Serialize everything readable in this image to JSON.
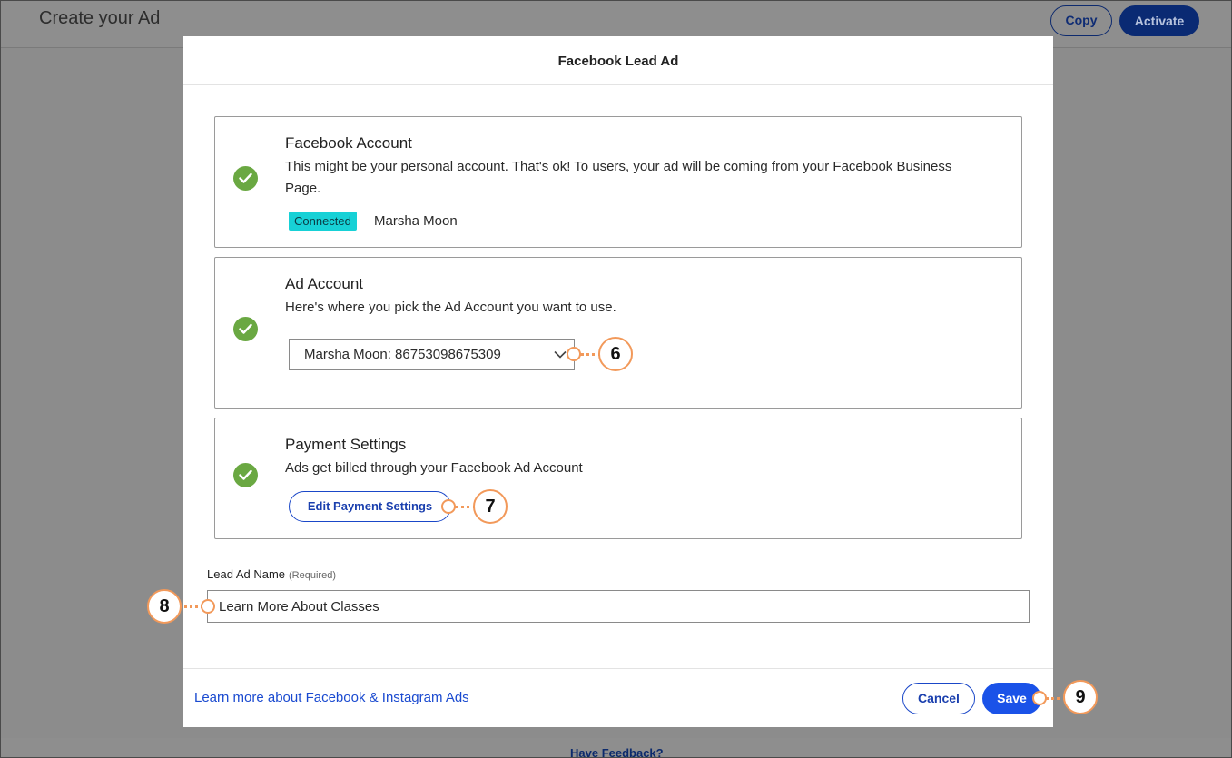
{
  "page": {
    "title": "Create your Ad",
    "copy_label": "Copy",
    "activate_label": "Activate",
    "feedback_label": "Have Feedback?"
  },
  "modal": {
    "title": "Facebook Lead Ad",
    "facebook_account": {
      "title": "Facebook Account",
      "description": "This might be your personal account. That's ok! To users, your ad will be coming from your Facebook Business Page.",
      "status_badge": "Connected",
      "account_name": "Marsha Moon"
    },
    "ad_account": {
      "title": "Ad Account",
      "description": "Here's where you pick the Ad Account you want to use.",
      "selected_value": "Marsha Moon: 86753098675309"
    },
    "payment_settings": {
      "title": "Payment Settings",
      "description": "Ads get billed through your Facebook Ad Account",
      "edit_label": "Edit Payment Settings"
    },
    "lead_ad_name": {
      "label": "Lead Ad Name",
      "required_note": "(Required)",
      "value": "Learn More About Classes"
    },
    "footer": {
      "learn_link": "Learn more about Facebook & Instagram Ads",
      "cancel_label": "Cancel",
      "save_label": "Save"
    }
  },
  "callouts": {
    "ad_account_select": "6",
    "edit_payment": "7",
    "lead_ad_name": "8",
    "save": "9"
  },
  "colors": {
    "accent_blue": "#1a52e8",
    "success_green": "#6aa842",
    "badge_cyan": "#17d1d6",
    "callout_orange": "#f2995a"
  }
}
